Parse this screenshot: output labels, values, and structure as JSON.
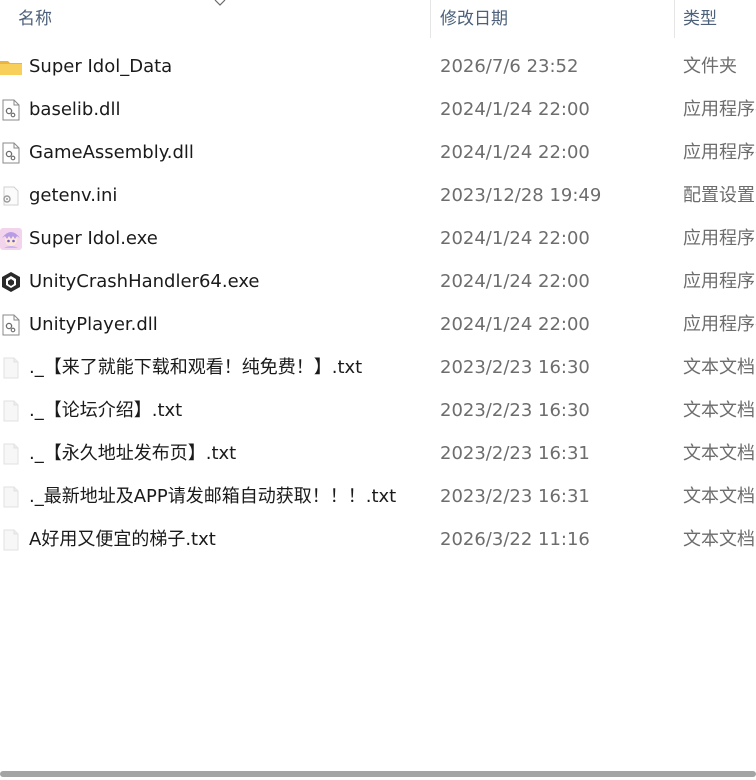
{
  "columns": {
    "name": "名称",
    "date": "修改日期",
    "type": "类型"
  },
  "files": [
    {
      "name": "Super Idol_Data",
      "date": "2026/7/6 23:52",
      "type": "文件夹",
      "icon": "folder-icon"
    },
    {
      "name": "baselib.dll",
      "date": "2024/1/24 22:00",
      "type": "应用程序扩展",
      "icon": "dll-file-icon"
    },
    {
      "name": "GameAssembly.dll",
      "date": "2024/1/24 22:00",
      "type": "应用程序扩展",
      "icon": "dll-file-icon"
    },
    {
      "name": "getenv.ini",
      "date": "2023/12/28 19:49",
      "type": "配置设置",
      "icon": "ini-file-icon"
    },
    {
      "name": "Super Idol.exe",
      "date": "2024/1/24 22:00",
      "type": "应用程序",
      "icon": "anime-app-icon"
    },
    {
      "name": "UnityCrashHandler64.exe",
      "date": "2024/1/24 22:00",
      "type": "应用程序",
      "icon": "unity-logo-icon"
    },
    {
      "name": "UnityPlayer.dll",
      "date": "2024/1/24 22:00",
      "type": "应用程序扩展",
      "icon": "dll-file-icon"
    },
    {
      "name": "._【来了就能下载和观看！纯免费！】.txt",
      "date": "2023/2/23 16:30",
      "type": "文本文档",
      "icon": "text-file-icon"
    },
    {
      "name": "._【论坛介绍】.txt",
      "date": "2023/2/23 16:30",
      "type": "文本文档",
      "icon": "text-file-icon"
    },
    {
      "name": "._【永久地址发布页】.txt",
      "date": "2023/2/23 16:31",
      "type": "文本文档",
      "icon": "text-file-icon"
    },
    {
      "name": "._最新地址及APP请发邮箱自动获取！！！.txt",
      "date": "2023/2/23 16:31",
      "type": "文本文档",
      "icon": "text-file-icon"
    },
    {
      "name": "A好用又便宜的梯子.txt",
      "date": "2026/3/22 11:16",
      "type": "文本文档",
      "icon": "text-file-icon"
    }
  ],
  "colors": {
    "header_text": "#4c607a",
    "name_text": "#1a1a1a",
    "meta_text": "#6d6d6d",
    "folder": "#f8cf5a",
    "scrollbar": "#a4a4a4"
  }
}
